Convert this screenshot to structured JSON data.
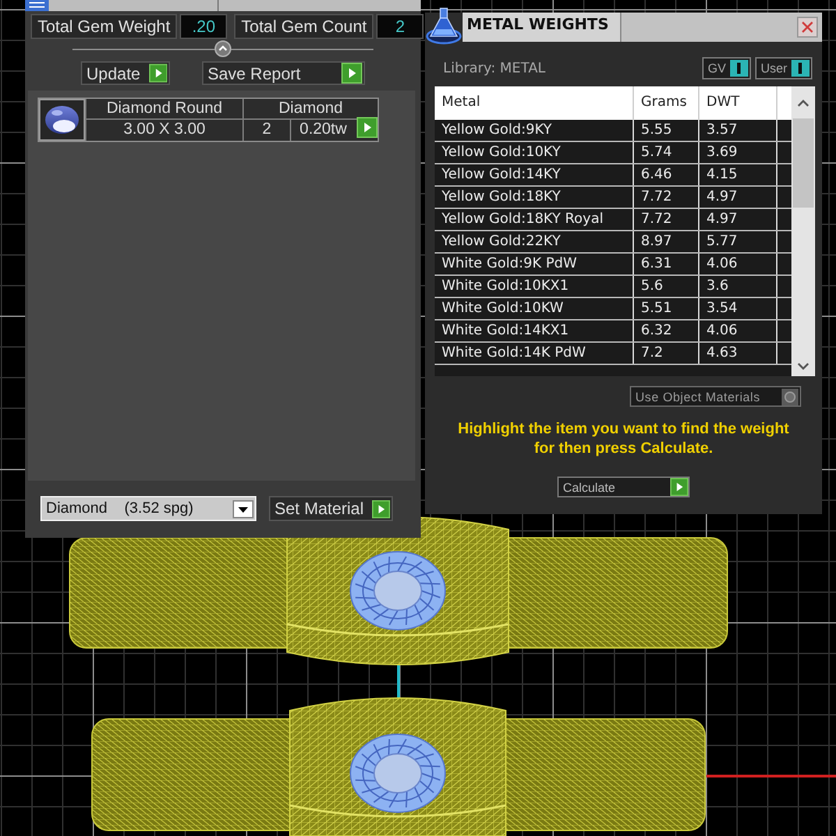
{
  "gem_panel": {
    "totals": [
      {
        "label": "Total Gem Weight",
        "value": ".20"
      },
      {
        "label": "Total Gem Count",
        "value": "2"
      }
    ],
    "buttons": [
      {
        "label": "Update"
      },
      {
        "label": "Save Report"
      }
    ],
    "gems": [
      {
        "name": "Diamond Round",
        "material": "Diamond",
        "size": "3.00 X 3.00",
        "count": "2",
        "weight": "0.20tw"
      }
    ],
    "material_dropdown": {
      "value": "Diamond    (3.52 spg)"
    },
    "set_material_button": {
      "label": "Set Material"
    }
  },
  "metal_panel": {
    "title": "METAL WEIGHTS",
    "library": "Library: METAL",
    "toggles": [
      {
        "label": "GV",
        "on": true
      },
      {
        "label": "User",
        "on": true
      }
    ],
    "table": {
      "columns": [
        "Metal",
        "Grams",
        "DWT"
      ],
      "rows": [
        {
          "metal": "Yellow Gold:9KY",
          "grams": "5.55",
          "dwt": "3.57",
          "selected": false
        },
        {
          "metal": "Yellow Gold:10KY",
          "grams": "5.74",
          "dwt": "3.69",
          "selected": false
        },
        {
          "metal": "Yellow Gold:14KY",
          "grams": "6.46",
          "dwt": "4.15",
          "selected": false
        },
        {
          "metal": "Yellow Gold:18KY",
          "grams": "7.72",
          "dwt": "4.97",
          "selected": false
        },
        {
          "metal": "Yellow Gold:18KY Royal",
          "grams": "7.72",
          "dwt": "4.97",
          "selected": false
        },
        {
          "metal": "Yellow Gold:22KY",
          "grams": "8.97",
          "dwt": "5.77",
          "selected": false
        },
        {
          "metal": "White Gold:9K PdW",
          "grams": "6.31",
          "dwt": "4.06",
          "selected": false
        },
        {
          "metal": "White Gold:10KX1",
          "grams": "5.6",
          "dwt": "3.6",
          "selected": false
        },
        {
          "metal": "White Gold:10KW",
          "grams": "5.51",
          "dwt": "3.54",
          "selected": false
        },
        {
          "metal": "White Gold:14KX1",
          "grams": "6.32",
          "dwt": "4.06",
          "selected": false
        },
        {
          "metal": "White Gold:14K PdW",
          "grams": "7.2",
          "dwt": "4.63",
          "selected": false
        }
      ]
    },
    "use_object_materials": {
      "label": "Use Object Materials",
      "checked": false
    },
    "instruction": "Highlight the item you want to find the weight for then press Calculate.",
    "calculate_button": {
      "label": "Calculate"
    }
  }
}
